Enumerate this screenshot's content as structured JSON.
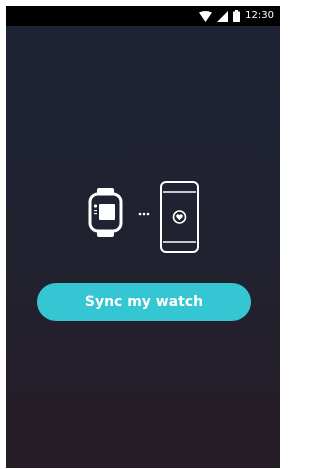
{
  "status_bar": {
    "time": "12:30",
    "icons": [
      "wifi-icon",
      "signal-icon",
      "battery-icon"
    ]
  },
  "illustration": {
    "icons": [
      "smartwatch-icon",
      "sync-dots-icon",
      "phone-heart-icon"
    ]
  },
  "sync_button": {
    "label": "Sync my watch"
  },
  "colors": {
    "background_top": "#1d2337",
    "background_bottom": "#261b26",
    "status_bar": "#000000",
    "button": "#35c6d3",
    "button_text": "#ffffff",
    "icon_stroke": "#ffffff"
  }
}
